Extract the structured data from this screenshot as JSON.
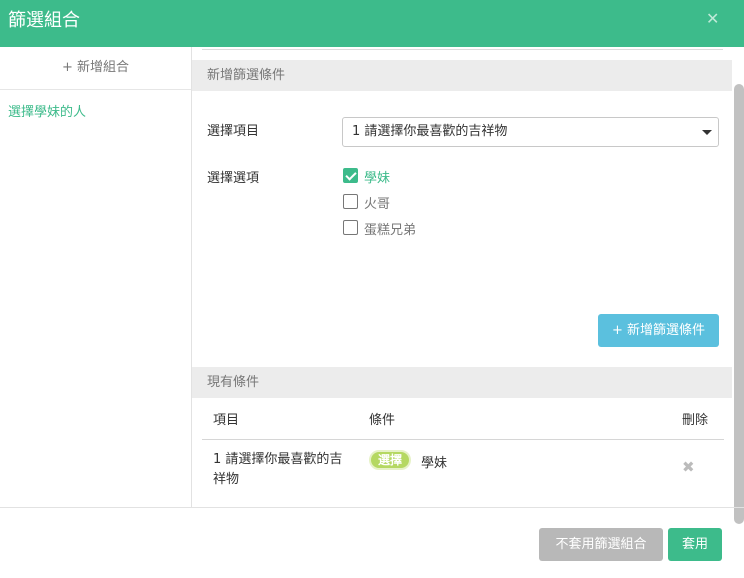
{
  "header": {
    "title": "篩選組合",
    "close_icon": "close-icon"
  },
  "sidebar": {
    "add_group_label": "+ 新增組合",
    "groups": [
      {
        "label": "選擇學妹的人"
      }
    ]
  },
  "new_condition": {
    "section_title": "新增篩選條件",
    "item_label": "選擇項目",
    "item_select_value": "1 請選擇你最喜歡的吉祥物",
    "option_label": "選擇選項",
    "options": [
      {
        "label": "學妹",
        "checked": true
      },
      {
        "label": "火哥",
        "checked": false
      },
      {
        "label": "蛋糕兄弟",
        "checked": false
      }
    ],
    "add_button_label": "+ 新增篩選條件"
  },
  "existing": {
    "section_title": "現有條件",
    "columns": [
      "項目",
      "條件",
      "刪除"
    ],
    "rows": [
      {
        "item": "1 請選擇你最喜歡的吉祥物",
        "badge": "選擇",
        "value": "學妹",
        "delete_icon": "✖"
      }
    ]
  },
  "footer": {
    "cancel_label": "不套用篩選組合",
    "apply_label": "套用"
  },
  "colors": {
    "accent": "#3dbb8b",
    "info": "#5bc0de",
    "badge": "#b5d862",
    "disabled": "#b8b8b8"
  }
}
